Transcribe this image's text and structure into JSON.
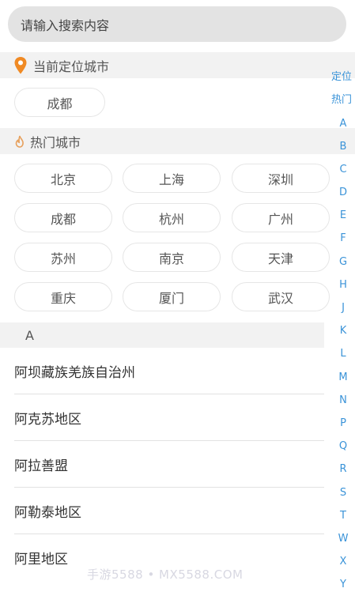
{
  "search": {
    "placeholder": "请输入搜索内容"
  },
  "location_section": {
    "title": "当前定位城市",
    "city": "成都"
  },
  "hot_section": {
    "title": "热门城市",
    "cities": [
      "北京",
      "上海",
      "深圳",
      "成都",
      "杭州",
      "广州",
      "苏州",
      "南京",
      "天津",
      "重庆",
      "厦门",
      "武汉"
    ]
  },
  "list_section": {
    "letter": "A",
    "cities": [
      "阿坝藏族羌族自治州",
      "阿克苏地区",
      "阿拉善盟",
      "阿勒泰地区",
      "阿里地区"
    ]
  },
  "index_bar": [
    "定位",
    "热门",
    "A",
    "B",
    "C",
    "D",
    "E",
    "F",
    "G",
    "H",
    "J",
    "K",
    "L",
    "M",
    "N",
    "P",
    "Q",
    "R",
    "S",
    "T",
    "W",
    "X",
    "Y"
  ],
  "watermark": "手游5588 • MX5588.COM",
  "colors": {
    "accent": "#3a93d8",
    "pin": "#f08a24",
    "flame": "#e7a15e"
  }
}
